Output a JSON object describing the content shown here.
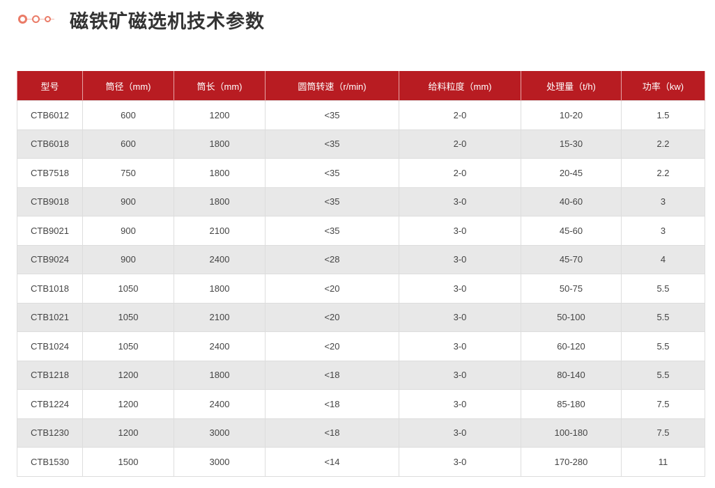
{
  "page": {
    "title": "磁铁矿磁选机技术参数"
  },
  "table": {
    "headers": [
      "型号",
      "筒径（mm)",
      "筒长（mm)",
      "圆筒转速（r/min)",
      "给料粒度（mm)",
      "处理量（t/h)",
      "功率（kw)"
    ],
    "rows": [
      [
        "CTB6012",
        "600",
        "1200",
        "<35",
        "2-0",
        "10-20",
        "1.5"
      ],
      [
        "CTB6018",
        "600",
        "1800",
        "<35",
        "2-0",
        "15-30",
        "2.2"
      ],
      [
        "CTB7518",
        "750",
        "1800",
        "<35",
        "2-0",
        "20-45",
        "2.2"
      ],
      [
        "CTB9018",
        "900",
        "1800",
        "<35",
        "3-0",
        "40-60",
        "3"
      ],
      [
        "CTB9021",
        "900",
        "2100",
        "<35",
        "3-0",
        "45-60",
        "3"
      ],
      [
        "CTB9024",
        "900",
        "2400",
        "<28",
        "3-0",
        "45-70",
        "4"
      ],
      [
        "CTB1018",
        "1050",
        "1800",
        "<20",
        "3-0",
        "50-75",
        "5.5"
      ],
      [
        "CTB1021",
        "1050",
        "2100",
        "<20",
        "3-0",
        "50-100",
        "5.5"
      ],
      [
        "CTB1024",
        "1050",
        "2400",
        "<20",
        "3-0",
        "60-120",
        "5.5"
      ],
      [
        "CTB1218",
        "1200",
        "1800",
        "<18",
        "3-0",
        "80-140",
        "5.5"
      ],
      [
        "CTB1224",
        "1200",
        "2400",
        "<18",
        "3-0",
        "85-180",
        "7.5"
      ],
      [
        "CTB1230",
        "1200",
        "3000",
        "<18",
        "3-0",
        "100-180",
        "7.5"
      ],
      [
        "CTB1530",
        "1500",
        "3000",
        "<14",
        "3-0",
        "170-280",
        "11"
      ]
    ]
  },
  "colors": {
    "header_bg": "#b81c22",
    "accent_dots": "#ea7b67",
    "stripe": "#e8e8e8"
  }
}
